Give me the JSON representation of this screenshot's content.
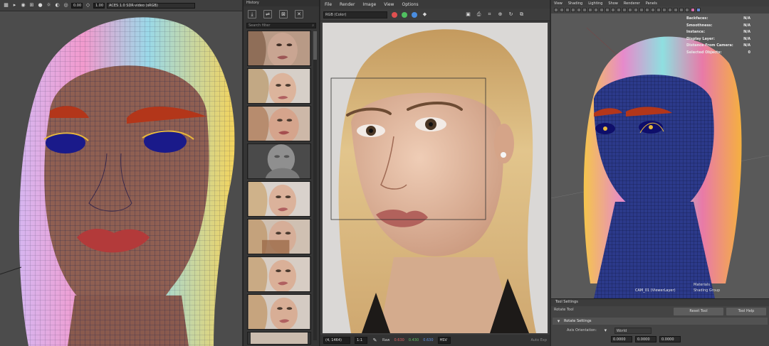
{
  "left_viewport": {
    "frame_start": "0.00",
    "frame_scale": "1.00",
    "color_space": "ACES 1.0 SDR-video (sRGB)"
  },
  "history": {
    "title": "History",
    "search_placeholder": "Search filter",
    "tool_icons": [
      "snapshot-icon",
      "compare-icon",
      "delete-icon",
      "close-icon"
    ]
  },
  "render_view": {
    "menu": [
      "File",
      "Render",
      "Image",
      "View",
      "Options"
    ],
    "channel_select": "RGB (Color)",
    "coords": "(4, 1464)",
    "ratio": "1:1",
    "raw_label": "Raw",
    "raw_r": "0.630",
    "raw_g": "0.430",
    "raw_b": "0.630",
    "mode": "HSV",
    "status": "Auto Exp"
  },
  "maya_viewport": {
    "menu": [
      "View",
      "Shading",
      "Lighting",
      "Show",
      "Renderer",
      "Panels"
    ],
    "hud": [
      {
        "label": "Backfaces:",
        "value": "N/A"
      },
      {
        "label": "Smoothness:",
        "value": "N/A"
      },
      {
        "label": "Instance:",
        "value": "N/A"
      },
      {
        "label": "Display Layer:",
        "value": "N/A"
      },
      {
        "label": "Distance From Camera:",
        "value": "N/A"
      },
      {
        "label": "Selected Objects:",
        "value": "0"
      }
    ],
    "camera_label": "CAM_01 (ViewerLayer)",
    "bottom_label_1": "Materials",
    "bottom_label_2": "Shading Group"
  },
  "tool_settings": {
    "tab": "Tool Settings",
    "tool_name": "Rotate Tool",
    "reset_button": "Reset Tool",
    "help_button": "Tool Help",
    "section": "Rotate Settings",
    "axis_orientation_label": "Axis Orientation:",
    "axis_orientation_value": "World",
    "values": [
      "0.0000",
      "0.0000",
      "0.0000"
    ]
  },
  "colors": {
    "wire": "#1e2a5a",
    "skin": "#8f5f52",
    "hair_pink": "#e68acb",
    "hair_yellow": "#e8b83c",
    "brow_red": "#b3361a"
  }
}
